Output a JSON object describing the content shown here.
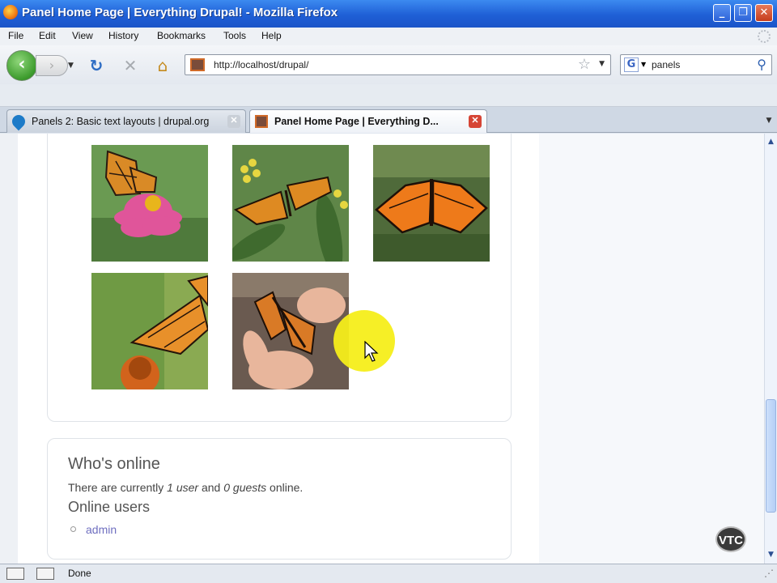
{
  "window": {
    "title": "Panel Home Page | Everything Drupal! - Mozilla Firefox",
    "controls": {
      "minimize": "_",
      "maximize": "❐",
      "close": "✕"
    }
  },
  "menu": [
    "File",
    "Edit",
    "View",
    "History",
    "Bookmarks",
    "Tools",
    "Help"
  ],
  "nav": {
    "url": "http://localhost/drupal/",
    "search_query": "panels",
    "search_engine_letter": "G"
  },
  "tabs": [
    {
      "label": "Panels 2: Basic text layouts | drupal.org",
      "active": false
    },
    {
      "label": "Panel Home Page | Everything D...",
      "active": true
    }
  ],
  "gallery": {
    "images": [
      {
        "subject": "monarch butterfly on pink zinnia"
      },
      {
        "subject": "monarch butterfly on milkweed leaves"
      },
      {
        "subject": "monarch butterfly with open wings"
      },
      {
        "subject": "monarch butterfly on orange coneflower"
      },
      {
        "subject": "monarch butterfly held in fingers"
      }
    ]
  },
  "whos_online": {
    "heading": "Who's online",
    "status_prefix": "There are currently ",
    "user_count": "1 user",
    "status_middle": " and ",
    "guest_count": "0 guests",
    "status_suffix": " online.",
    "subheading": "Online users",
    "users": [
      "admin"
    ]
  },
  "watermark": "VTC",
  "statusbar": {
    "text": "Done"
  },
  "colors": {
    "titlebar": "#1f5fd6",
    "highlight": "#f6ee1a",
    "link": "#6f6fc0"
  }
}
